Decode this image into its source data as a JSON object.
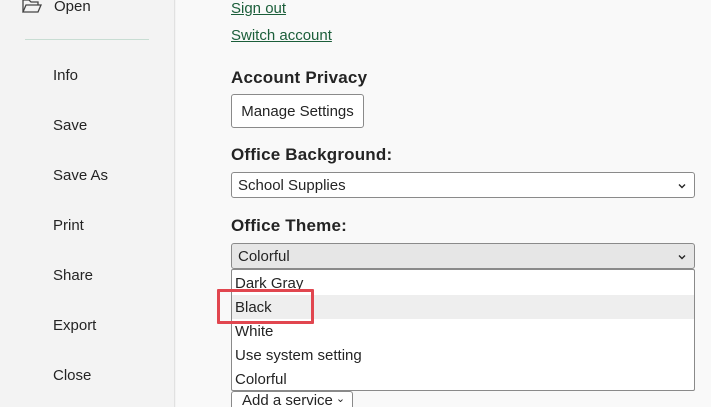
{
  "sidebar": {
    "open_label": "Open",
    "items": [
      {
        "label": "Info"
      },
      {
        "label": "Save"
      },
      {
        "label": "Save As"
      },
      {
        "label": "Print"
      },
      {
        "label": "Share"
      },
      {
        "label": "Export"
      },
      {
        "label": "Close"
      }
    ]
  },
  "account": {
    "sign_out": "Sign out",
    "switch_account": "Switch account",
    "privacy_title": "Account Privacy",
    "manage_settings": "Manage Settings",
    "background_title": "Office Background:",
    "background_value": "School Supplies",
    "theme_title": "Office Theme:",
    "theme_value": "Colorful",
    "theme_options": [
      "Dark Gray",
      "Black",
      "White",
      "Use system setting",
      "Colorful"
    ],
    "add_service": "Add a service"
  },
  "colors": {
    "link": "#1b5e3a",
    "highlight": "#e1464f"
  }
}
